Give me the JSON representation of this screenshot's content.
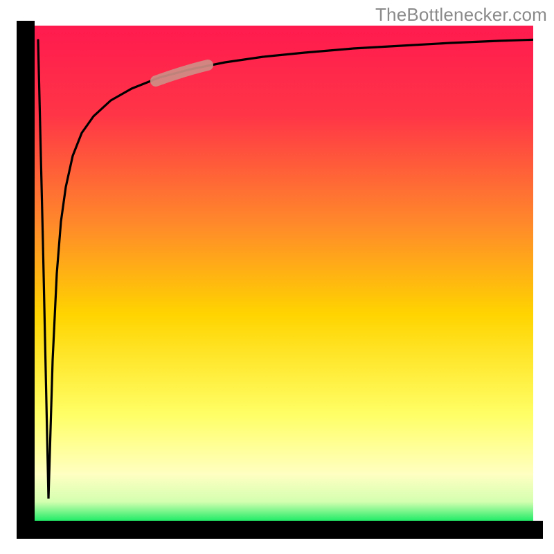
{
  "watermark": "TheBottlenecker.com",
  "colors": {
    "gradient_top": "#ff1a4e",
    "gradient_mid_upper": "#ff7b2f",
    "gradient_mid": "#ffe300",
    "gradient_lower": "#ffff8a",
    "gradient_bottom": "#00e85a",
    "axis": "#000000",
    "curve": "#000000",
    "highlight": "#cf8d86"
  },
  "chart_data": {
    "type": "line",
    "title": "",
    "xlabel": "",
    "ylabel": "",
    "xlim": [
      0,
      100
    ],
    "ylim": [
      0,
      100
    ],
    "grid": false,
    "legend": null,
    "annotations": [
      "TheBottlenecker.com"
    ],
    "series": [
      {
        "name": "bottleneck-curve",
        "x": [
          0,
          0.5,
          1,
          1.5,
          2,
          2.5,
          3,
          4,
          5,
          6,
          8,
          10,
          14,
          18,
          22,
          26,
          30,
          35,
          40,
          50,
          60,
          70,
          80,
          90,
          100
        ],
        "y": [
          97,
          40,
          5,
          32,
          50,
          60,
          66,
          73,
          77,
          80,
          83,
          85,
          87.5,
          89,
          90,
          90.8,
          91.5,
          92,
          92.5,
          93.2,
          93.8,
          94.2,
          94.5,
          94.7,
          94.9
        ]
      }
    ],
    "highlight_segment": {
      "series": "bottleneck-curve",
      "x_range": [
        24,
        36
      ],
      "y_range": [
        86.5,
        89
      ]
    }
  }
}
